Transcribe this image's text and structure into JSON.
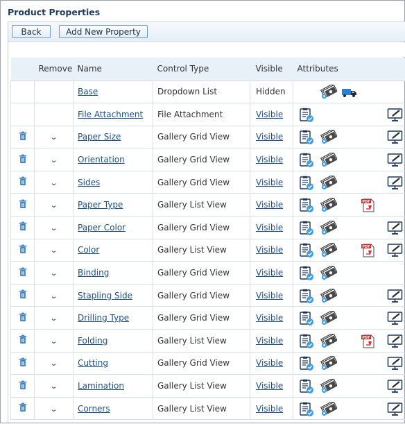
{
  "page": {
    "title": "Product Properties"
  },
  "toolbar": {
    "back_label": "Back",
    "add_label": "Add New Property"
  },
  "table": {
    "headers": {
      "remove": "Remove",
      "name": "Name",
      "control_type": "Control Type",
      "visible": "Visible",
      "attributes": "Attributes"
    },
    "rows": [
      {
        "name": "Base",
        "control_type": "Dropdown List",
        "visible": "Hidden",
        "visible_link": false,
        "deletable": false,
        "attributes": [
          "money-gear-icon",
          "truck-icon"
        ]
      },
      {
        "name": "File Attachment",
        "control_type": "File Attachment",
        "visible": "Visible",
        "visible_link": true,
        "deletable": false,
        "attributes": [
          "clipboard-check-icon",
          "monitor-edit-icon"
        ]
      },
      {
        "name": "Paper Size",
        "control_type": "Gallery Grid View",
        "visible": "Visible",
        "visible_link": true,
        "deletable": true,
        "attributes": [
          "clipboard-check-icon",
          "money-gear-icon",
          "monitor-edit-icon"
        ]
      },
      {
        "name": "Orientation",
        "control_type": "Gallery Grid View",
        "visible": "Visible",
        "visible_link": true,
        "deletable": true,
        "attributes": [
          "clipboard-check-icon",
          "money-gear-icon",
          "monitor-edit-icon"
        ]
      },
      {
        "name": "Sides",
        "control_type": "Gallery Grid View",
        "visible": "Visible",
        "visible_link": true,
        "deletable": true,
        "attributes": [
          "clipboard-check-icon",
          "money-gear-icon",
          "monitor-edit-icon"
        ]
      },
      {
        "name": "Paper Type",
        "control_type": "Gallery List View",
        "visible": "Visible",
        "visible_link": true,
        "deletable": true,
        "attributes": [
          "clipboard-check-icon",
          "money-gear-icon",
          "pdf-icon"
        ]
      },
      {
        "name": "Paper Color",
        "control_type": "Gallery Grid View",
        "visible": "Visible",
        "visible_link": true,
        "deletable": true,
        "attributes": [
          "clipboard-check-icon",
          "money-gear-icon",
          "monitor-edit-icon"
        ]
      },
      {
        "name": "Color",
        "control_type": "Gallery List View",
        "visible": "Visible",
        "visible_link": true,
        "deletable": true,
        "attributes": [
          "clipboard-check-icon",
          "money-gear-icon",
          "pdf-icon",
          "monitor-edit-icon"
        ]
      },
      {
        "name": "Binding",
        "control_type": "Gallery Grid View",
        "visible": "Visible",
        "visible_link": true,
        "deletable": true,
        "attributes": [
          "clipboard-check-icon",
          "money-gear-icon"
        ]
      },
      {
        "name": "Stapling Side",
        "control_type": "Gallery Grid View",
        "visible": "Visible",
        "visible_link": true,
        "deletable": true,
        "attributes": [
          "clipboard-check-icon",
          "money-gear-icon",
          "monitor-edit-icon"
        ]
      },
      {
        "name": "Drilling Type",
        "control_type": "Gallery Grid View",
        "visible": "Visible",
        "visible_link": true,
        "deletable": true,
        "attributes": [
          "clipboard-check-icon",
          "money-gear-icon",
          "monitor-edit-icon"
        ]
      },
      {
        "name": "Folding",
        "control_type": "Gallery List View",
        "visible": "Visible",
        "visible_link": true,
        "deletable": true,
        "attributes": [
          "clipboard-check-icon",
          "money-gear-icon",
          "pdf-icon",
          "monitor-edit-icon"
        ]
      },
      {
        "name": "Cutting",
        "control_type": "Gallery Grid View",
        "visible": "Visible",
        "visible_link": true,
        "deletable": true,
        "attributes": [
          "clipboard-check-icon",
          "money-gear-icon",
          "monitor-edit-icon"
        ]
      },
      {
        "name": "Lamination",
        "control_type": "Gallery List View",
        "visible": "Visible",
        "visible_link": true,
        "deletable": true,
        "attributes": [
          "clipboard-check-icon",
          "money-gear-icon",
          "monitor-edit-icon"
        ]
      },
      {
        "name": "Corners",
        "control_type": "Gallery List View",
        "visible": "Visible",
        "visible_link": true,
        "deletable": true,
        "attributes": [
          "clipboard-check-icon",
          "money-gear-icon",
          "monitor-edit-icon"
        ]
      }
    ]
  },
  "colors": {
    "title": "#1f3a5f",
    "link": "#1c4f86",
    "header_bg": "#e9f1f8",
    "trash": "#3d7fc4",
    "button_border": "#6f97bf"
  }
}
